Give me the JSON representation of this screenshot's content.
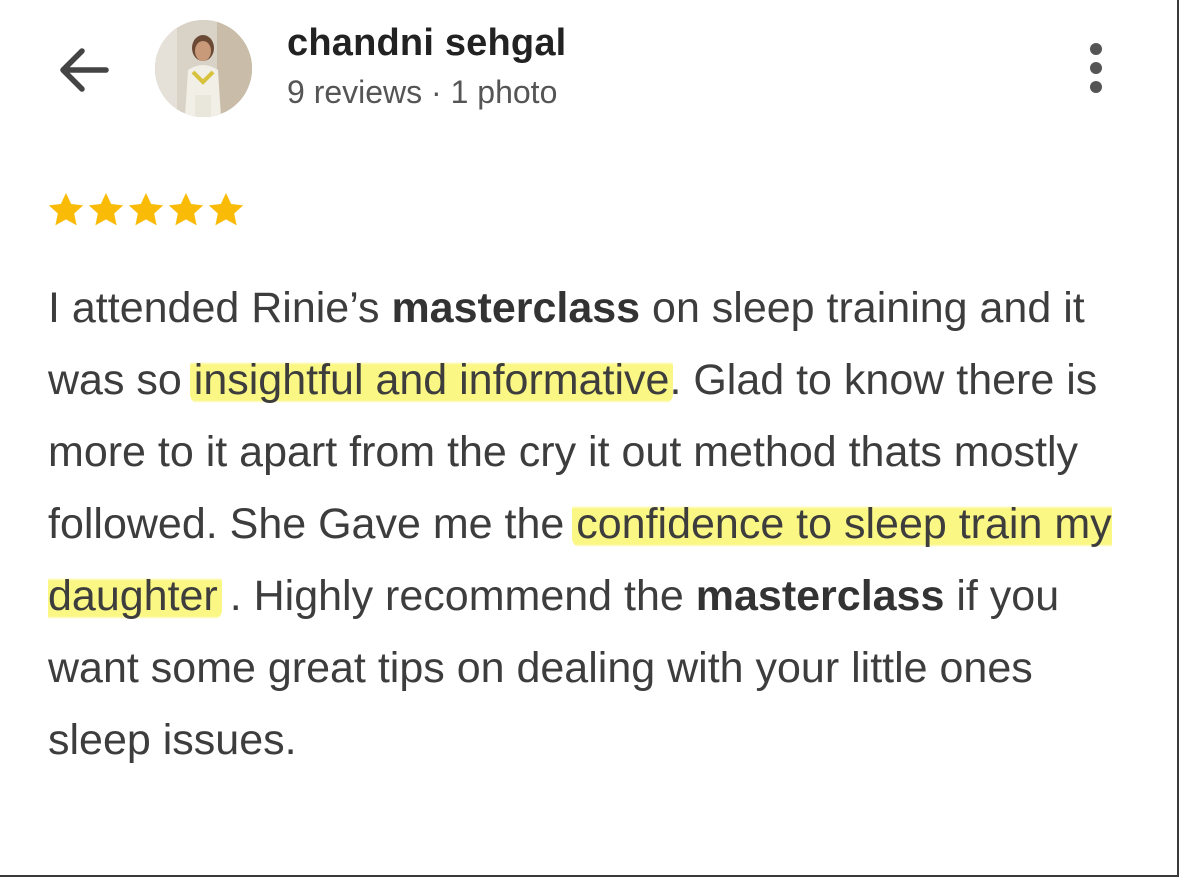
{
  "header": {
    "user_name": "chandni sehgal",
    "user_meta": "9 reviews · 1 photo",
    "back_icon": "arrow-back-icon",
    "menu_icon": "more-vert-icon"
  },
  "rating": {
    "stars": 5,
    "max": 5,
    "color": "#F9BB06"
  },
  "review": {
    "p1": "I attended Rinie’s ",
    "b1": "masterclass",
    "p2": " on sleep training and it was so ",
    "h1": "insightful and informative",
    "p3": ". Glad to know there is more to it apart from the cry it out method thats mostly followed. She Gave me the ",
    "h2": "confidence to sleep train my daughter",
    "p4": " . Highly recommend the ",
    "b2": "masterclass",
    "p5": " if you want some great tips on dealing with your little ones sleep issues.",
    "highlight_color": "#FAF678"
  }
}
